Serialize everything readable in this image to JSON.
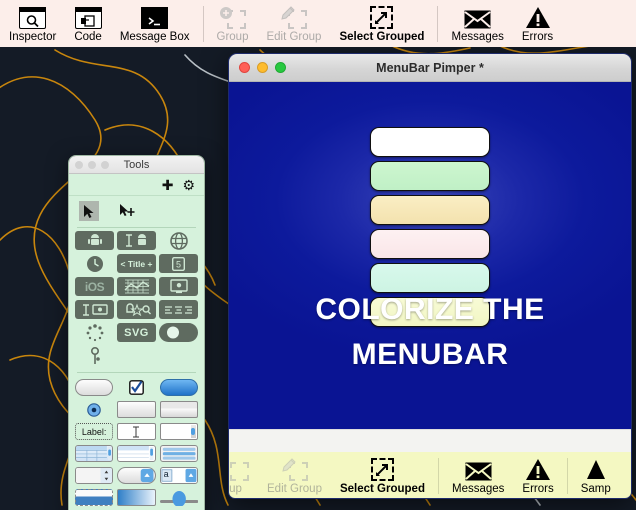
{
  "desktop": {
    "background_color": "#141b26",
    "line_colors": [
      "#c8860d",
      "#b9c0c6"
    ]
  },
  "top_toolbar": {
    "background_color": "#fceeea",
    "items": [
      {
        "label": "Inspector",
        "icon": "magnifier-window-icon",
        "state": "enabled"
      },
      {
        "label": "Code",
        "icon": "code-window-icon",
        "state": "enabled"
      },
      {
        "label": "Message Box",
        "icon": "terminal-window-icon",
        "state": "enabled"
      },
      {
        "label": "Group",
        "icon": "group-add-icon",
        "state": "disabled"
      },
      {
        "label": "Edit Group",
        "icon": "edit-group-icon",
        "state": "disabled"
      },
      {
        "label": "Select Grouped",
        "icon": "select-grouped-icon",
        "state": "active"
      },
      {
        "label": "Messages",
        "icon": "envelope-icon",
        "state": "enabled"
      },
      {
        "label": "Errors",
        "icon": "warning-triangle-icon",
        "state": "enabled"
      }
    ]
  },
  "pimper_window": {
    "title": "MenuBar Pimper *",
    "traffic_lights": [
      "close",
      "minimize",
      "zoom"
    ],
    "canvas_background": "#0d1a9c",
    "headline_line1": "COLORIZE THE",
    "headline_line2": "MENUBAR",
    "swatches": [
      {
        "name": "swatch-white",
        "color": "#ffffff"
      },
      {
        "name": "swatch-mint-green",
        "color": "#c8f5cb"
      },
      {
        "name": "swatch-cream",
        "color": "#f7e9bb"
      },
      {
        "name": "swatch-pale-pink",
        "color": "#fbeced"
      },
      {
        "name": "swatch-aqua",
        "color": "#d3f6e8"
      },
      {
        "name": "swatch-pale-yellow",
        "color": "#f5f8cd"
      }
    ],
    "bottom_toolbar": {
      "background_color": "#f4f8c2",
      "items": [
        {
          "label": "up",
          "icon": "group-add-icon",
          "state": "disabled"
        },
        {
          "label": "Edit Group",
          "icon": "edit-group-icon",
          "state": "disabled"
        },
        {
          "label": "Select Grouped",
          "icon": "select-grouped-icon",
          "state": "active"
        },
        {
          "label": "Messages",
          "icon": "envelope-icon",
          "state": "enabled"
        },
        {
          "label": "Errors",
          "icon": "warning-triangle-icon",
          "state": "enabled"
        },
        {
          "label": "Samp",
          "icon": "sample-icon",
          "state": "enabled"
        }
      ]
    }
  },
  "tools_window": {
    "title": "Tools",
    "background_color": "#d6f2dc",
    "actions": [
      {
        "name": "add-button",
        "glyph": "✚"
      },
      {
        "name": "settings-button",
        "glyph": "⚙"
      }
    ],
    "cursor_tools": [
      {
        "name": "select-arrow-tool",
        "glyph": "➤",
        "selected": true
      },
      {
        "name": "move-arrow-tool",
        "glyph": "➤",
        "selected": false
      }
    ],
    "widget_rows": [
      [
        {
          "label": "",
          "icon": "android-icon"
        },
        {
          "label": "",
          "icon": "text-android-icon"
        },
        {
          "label": "",
          "icon": "globe-icon"
        }
      ],
      [
        {
          "label": "",
          "icon": "clock-icon"
        },
        {
          "label": "< Title +",
          "icon": "titlebar-icon"
        },
        {
          "label": "5",
          "icon": "html5-icon"
        }
      ],
      [
        {
          "label": "iOS",
          "icon": "ios-icon"
        },
        {
          "label": "",
          "icon": "chart-icon"
        },
        {
          "label": "",
          "icon": "monitor-apple-icon"
        }
      ],
      [
        {
          "label": "",
          "icon": "text-monitor-icon"
        },
        {
          "label": "",
          "icon": "toolbar-icon"
        },
        {
          "label": "",
          "icon": "align-icon"
        }
      ],
      [
        {
          "label": "",
          "icon": "spinner-icon"
        },
        {
          "label": "SVG",
          "icon": "svg-icon"
        },
        {
          "label": "",
          "icon": "switch-icon"
        }
      ],
      [
        {
          "label": "",
          "icon": "key-icon"
        },
        {
          "label": "",
          "icon": ""
        },
        {
          "label": "",
          "icon": ""
        }
      ]
    ],
    "ui_rows": [
      [
        {
          "icon": "pill-button"
        },
        {
          "icon": "checkbox"
        },
        {
          "icon": "blue-button"
        }
      ],
      [
        {
          "icon": "radio-button"
        },
        {
          "icon": "text-box"
        },
        {
          "icon": "save-icon"
        }
      ],
      [
        {
          "icon": "label-field",
          "label": "Label:"
        },
        {
          "icon": "text-field"
        },
        {
          "icon": "scroll-view"
        }
      ],
      [
        {
          "icon": "table-view"
        },
        {
          "icon": "list-view"
        },
        {
          "icon": "slider-group"
        }
      ],
      [
        {
          "icon": "stepper"
        },
        {
          "icon": "popup-button"
        },
        {
          "icon": "combo-box",
          "label": "a"
        }
      ],
      [
        {
          "icon": "drag-view"
        },
        {
          "icon": "gradient-view"
        },
        {
          "icon": "knob-slider"
        }
      ]
    ]
  }
}
